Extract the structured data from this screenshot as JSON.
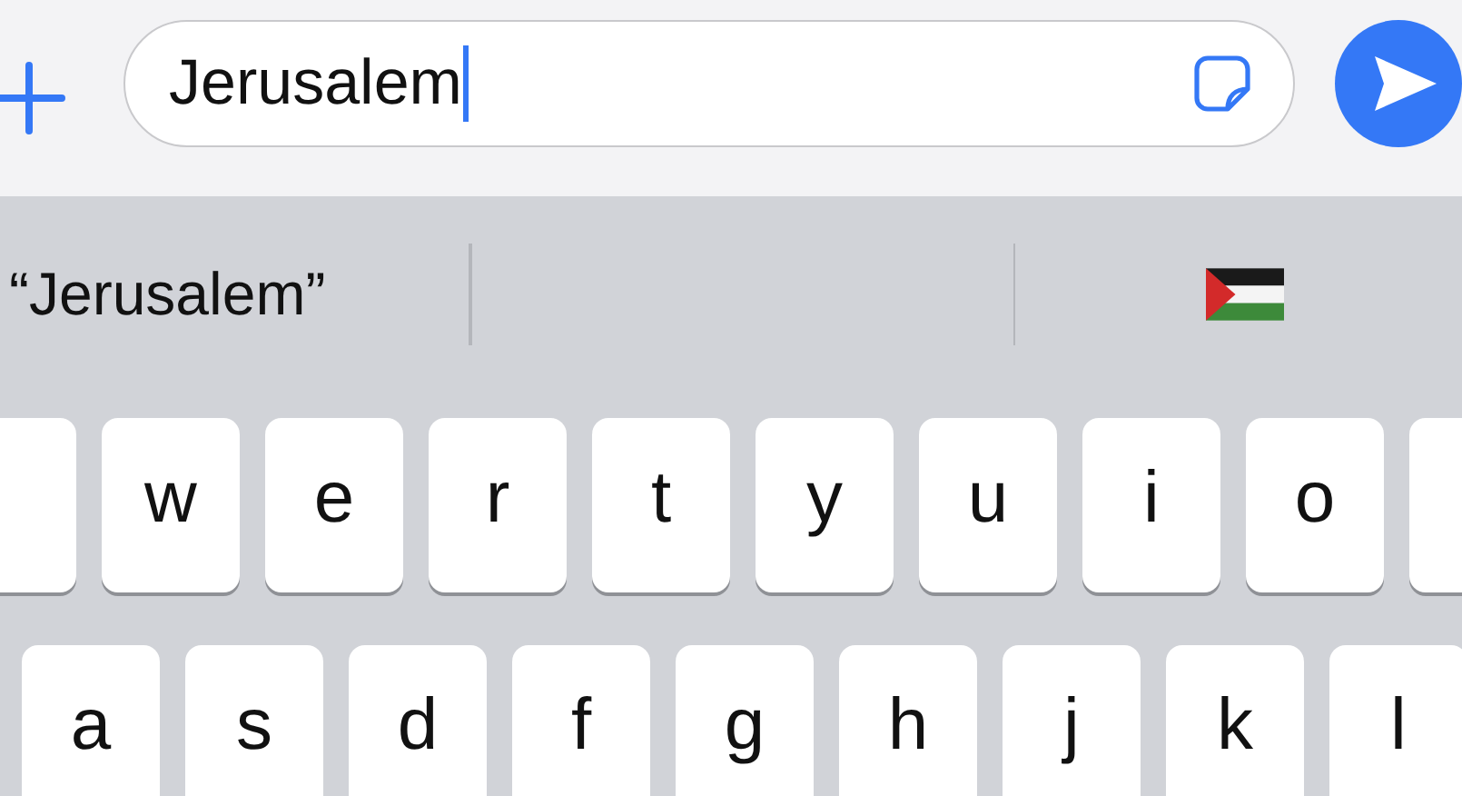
{
  "message_field": {
    "value": "Jerusalem"
  },
  "suggestions": [
    {
      "kind": "text",
      "label": "“Jerusalem”"
    },
    {
      "kind": "empty"
    },
    {
      "kind": "flag"
    }
  ],
  "keyboard": {
    "rows": [
      {
        "keys": [
          {
            "kind": "cut"
          },
          {
            "kind": "letter",
            "label": "w"
          },
          {
            "kind": "letter",
            "label": "e"
          },
          {
            "kind": "letter",
            "label": "r"
          },
          {
            "kind": "letter",
            "label": "t"
          },
          {
            "kind": "letter",
            "label": "y"
          },
          {
            "kind": "letter",
            "label": "u"
          },
          {
            "kind": "letter",
            "label": "i"
          },
          {
            "kind": "letter",
            "label": "o"
          },
          {
            "kind": "cut"
          }
        ]
      },
      {
        "keys": [
          {
            "kind": "letter",
            "label": "a"
          },
          {
            "kind": "letter",
            "label": "s"
          },
          {
            "kind": "letter",
            "label": "d"
          },
          {
            "kind": "letter",
            "label": "f"
          },
          {
            "kind": "letter",
            "label": "g"
          },
          {
            "kind": "letter",
            "label": "h"
          },
          {
            "kind": "letter",
            "label": "j"
          },
          {
            "kind": "letter",
            "label": "k"
          },
          {
            "kind": "letter",
            "label": "l"
          }
        ]
      }
    ]
  }
}
